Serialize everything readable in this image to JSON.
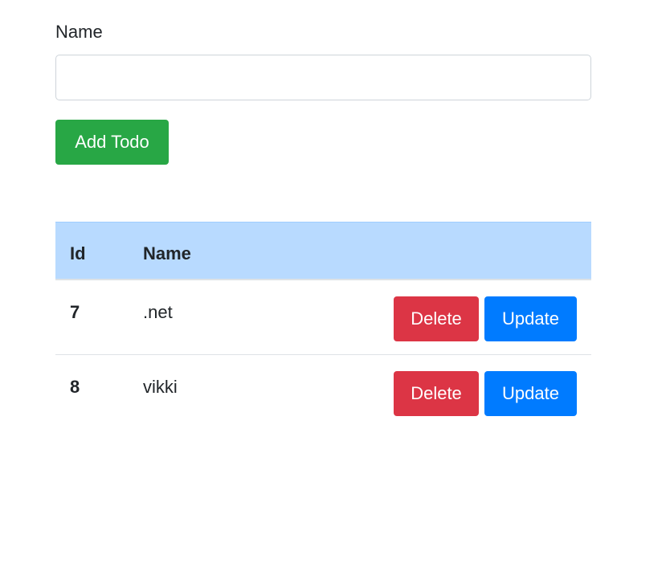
{
  "form": {
    "name_label": "Name",
    "name_value": "",
    "name_placeholder": "",
    "add_button_label": "Add Todo"
  },
  "table": {
    "headers": {
      "id": "Id",
      "name": "Name"
    },
    "rows": [
      {
        "id": "7",
        "name": ".net",
        "delete_label": "Delete",
        "update_label": "Update"
      },
      {
        "id": "8",
        "name": "vikki",
        "delete_label": "Delete",
        "update_label": "Update"
      }
    ]
  },
  "colors": {
    "add_button": "#28a745",
    "delete_button": "#dc3545",
    "update_button": "#007bff",
    "table_header_bg": "#b8daff"
  }
}
